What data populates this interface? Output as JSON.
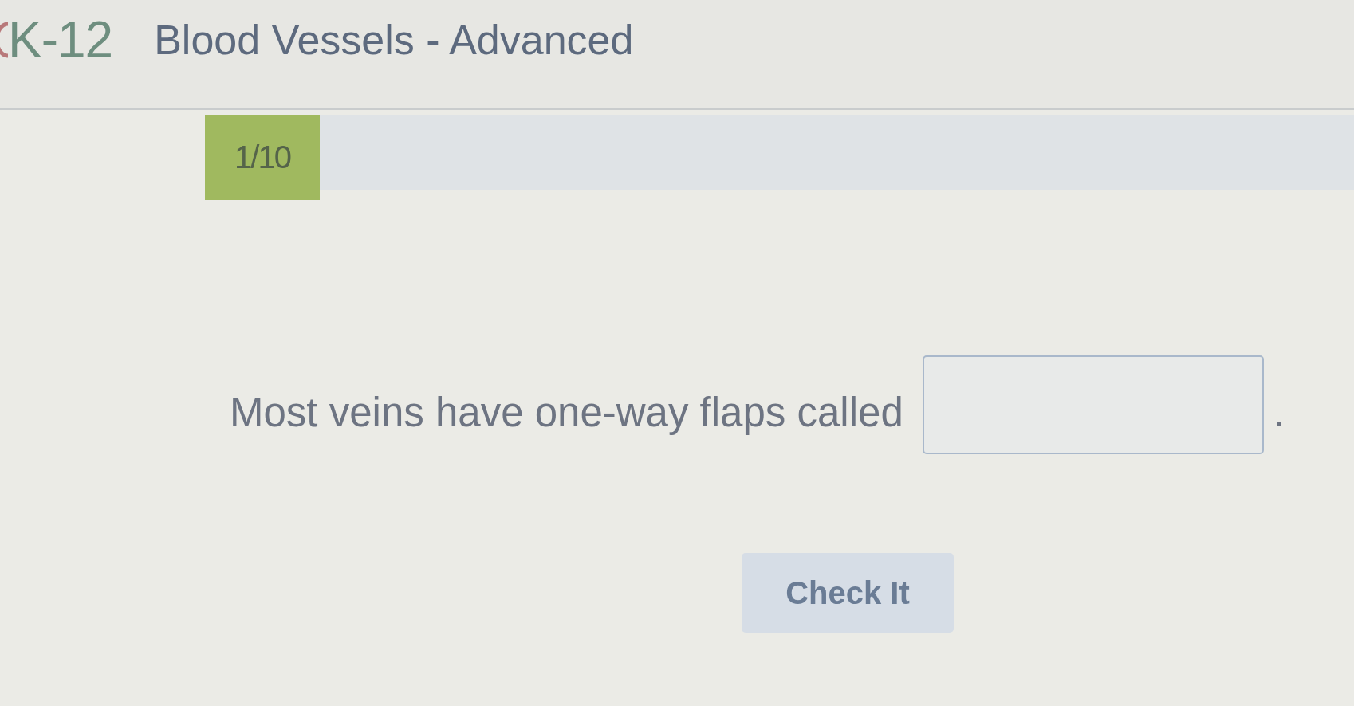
{
  "header": {
    "logo": "K-12",
    "title": "Blood Vessels - Advanced"
  },
  "progress": {
    "label": "1/10",
    "level": 0.1
  },
  "question": {
    "parts": [
      {
        "kind": "text",
        "text": "Most veins have one-way flaps called"
      },
      {
        "kind": "blank"
      },
      {
        "kind": "text",
        "text": "."
      }
    ]
  },
  "button": {
    "label": "Check It"
  }
}
